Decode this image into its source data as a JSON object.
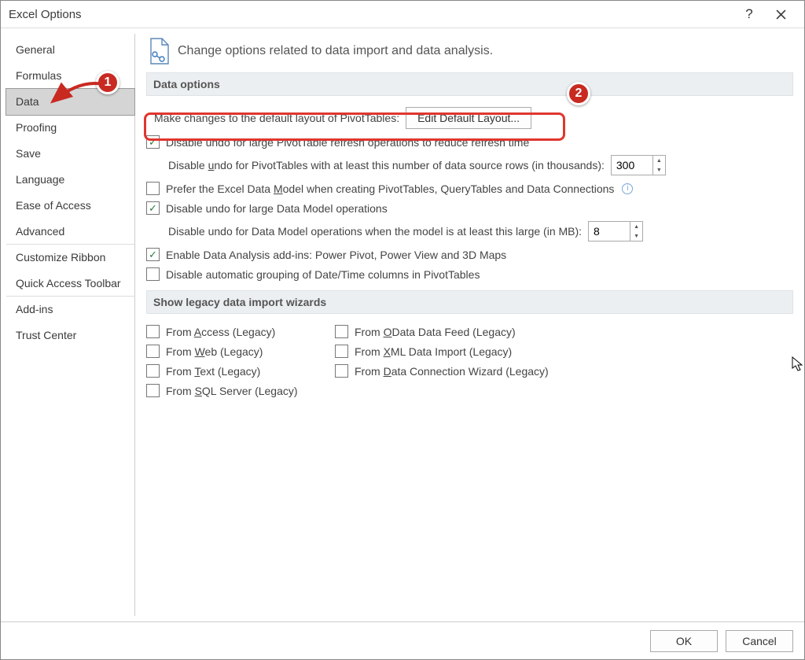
{
  "window": {
    "title": "Excel Options"
  },
  "sidebar": {
    "items": [
      {
        "label": "General",
        "selected": false,
        "sep": false
      },
      {
        "label": "Formulas",
        "selected": false,
        "sep": false
      },
      {
        "label": "Data",
        "selected": true,
        "sep": false
      },
      {
        "label": "Proofing",
        "selected": false,
        "sep": false
      },
      {
        "label": "Save",
        "selected": false,
        "sep": false
      },
      {
        "label": "Language",
        "selected": false,
        "sep": false
      },
      {
        "label": "Ease of Access",
        "selected": false,
        "sep": false
      },
      {
        "label": "Advanced",
        "selected": false,
        "sep": true
      },
      {
        "label": "Customize Ribbon",
        "selected": false,
        "sep": false
      },
      {
        "label": "Quick Access Toolbar",
        "selected": false,
        "sep": true
      },
      {
        "label": "Add-ins",
        "selected": false,
        "sep": false
      },
      {
        "label": "Trust Center",
        "selected": false,
        "sep": false
      }
    ]
  },
  "main": {
    "heading": "Change options related to data import and data analysis.",
    "section_data_options": "Data options",
    "pivot_layout_label": "Make changes to the default layout of PivotTables:",
    "edit_default_btn": "Edit Default Layout...",
    "disable_undo_large_pt": "Disable undo for large PivotTable refresh operations to reduce refresh time",
    "disable_undo_threshold_prefix": "Disable ",
    "disable_undo_threshold_u": "u",
    "disable_undo_threshold_mid": "ndo for PivotTables with at least this number of data source rows (in thousands):",
    "threshold_value": "300",
    "prefer_dm_prefix": "Prefer the Excel Data ",
    "prefer_dm_m": "M",
    "prefer_dm_rest": "odel when creating PivotTables, QueryTables and Data Connections",
    "disable_undo_dm": "Disable undo for large Data Model operations",
    "disable_undo_dm_size_label": "Disable undo for Data Model operations when the model is at least this large (in MB):",
    "dm_size_value": "8",
    "enable_addins": "Enable Data Analysis add-ins: Power Pivot, Power View and 3D Maps",
    "disable_auto_group": "Disable automatic grouping of Date/Time columns in PivotTables",
    "section_legacy": "Show legacy data import wizards",
    "legacy": {
      "access_pre": "From ",
      "access_u": "A",
      "access_post": "ccess (Legacy)",
      "web_pre": "From ",
      "web_u": "W",
      "web_post": "eb (Legacy)",
      "text_pre": "From ",
      "text_u": "T",
      "text_post": "ext (Legacy)",
      "sql_pre": "From ",
      "sql_u": "S",
      "sql_post": "QL Server (Legacy)",
      "odata_pre": "From ",
      "odata_u": "O",
      "odata_post": "Data Data Feed (Legacy)",
      "xml_pre": "From ",
      "xml_u": "X",
      "xml_post": "ML Data Import (Legacy)",
      "dcw_pre": "From ",
      "dcw_u": "D",
      "dcw_post": "ata Connection Wizard (Legacy)"
    }
  },
  "footer": {
    "ok": "OK",
    "cancel": "Cancel"
  },
  "annotations": {
    "badge1": "1",
    "badge2": "2"
  }
}
